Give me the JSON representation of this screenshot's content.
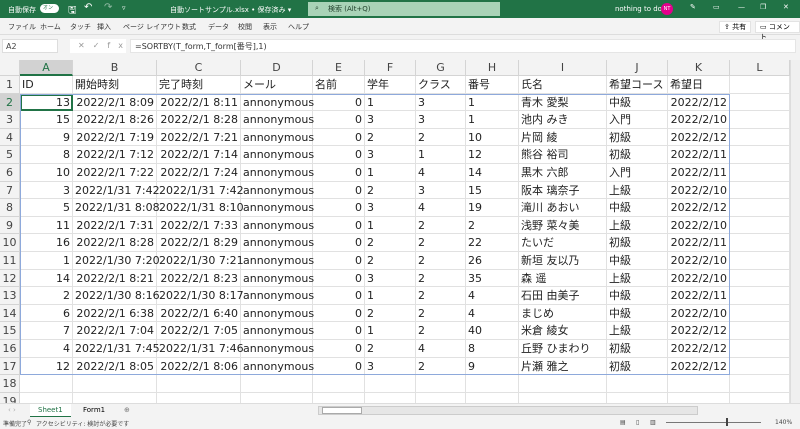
{
  "titlebar": {
    "autosave": "自動保存",
    "autosave_state": "オン",
    "filename": "自動ソートサンプル.xlsx • 保存済み ▾",
    "search": "検索 (Alt+Q)",
    "user": "nothing to do",
    "avatar": "NT"
  },
  "menu": [
    "ファイル",
    "ホーム",
    "タッチ",
    "挿入",
    "ページ レイアウト",
    "数式",
    "データ",
    "校閲",
    "表示",
    "ヘルプ"
  ],
  "share": "共有",
  "comment": "コメント",
  "formula_bar": {
    "name_box": "A2",
    "fx": "✕✓fx",
    "formula": "=SORTBY(T_form,T_form[番号],1)"
  },
  "columns": [
    "A",
    "B",
    "C",
    "D",
    "E",
    "F",
    "G",
    "H",
    "I",
    "J",
    "K",
    "L"
  ],
  "headers": [
    "ID",
    "開始時刻",
    "完了時刻",
    "メール",
    "名前",
    "学年",
    "クラス",
    "番号",
    "氏名",
    "希望コース",
    "希望日"
  ],
  "rows": [
    [
      "13",
      "2022/2/1 8:09",
      "2022/2/1 8:11",
      "annonymous",
      "0",
      "1",
      "3",
      "1",
      "青木 愛梨",
      "中級",
      "2022/2/12"
    ],
    [
      "15",
      "2022/2/1 8:26",
      "2022/2/1 8:28",
      "annonymous",
      "0",
      "3",
      "3",
      "1",
      "池内 みき",
      "入門",
      "2022/2/10"
    ],
    [
      "9",
      "2022/2/1 7:19",
      "2022/2/1 7:21",
      "annonymous",
      "0",
      "2",
      "2",
      "10",
      "片岡 綾",
      "初級",
      "2022/2/12"
    ],
    [
      "8",
      "2022/2/1 7:12",
      "2022/2/1 7:14",
      "annonymous",
      "0",
      "3",
      "1",
      "12",
      "熊谷 裕司",
      "初級",
      "2022/2/11"
    ],
    [
      "10",
      "2022/2/1 7:22",
      "2022/2/1 7:24",
      "annonymous",
      "0",
      "1",
      "4",
      "14",
      "黒木 六郎",
      "入門",
      "2022/2/11"
    ],
    [
      "3",
      "2022/1/31 7:42",
      "2022/1/31 7:42",
      "annonymous",
      "0",
      "2",
      "3",
      "15",
      "阪本 璃奈子",
      "上級",
      "2022/2/10"
    ],
    [
      "5",
      "2022/1/31 8:08",
      "2022/1/31 8:10",
      "annonymous",
      "0",
      "3",
      "4",
      "19",
      "滝川 あおい",
      "中級",
      "2022/2/12"
    ],
    [
      "11",
      "2022/2/1 7:31",
      "2022/2/1 7:33",
      "annonymous",
      "0",
      "1",
      "2",
      "2",
      "浅野 菜々美",
      "上級",
      "2022/2/10"
    ],
    [
      "16",
      "2022/2/1 8:28",
      "2022/2/1 8:29",
      "annonymous",
      "0",
      "2",
      "2",
      "22",
      "たいだ",
      "初級",
      "2022/2/11"
    ],
    [
      "1",
      "2022/1/30 7:20",
      "2022/1/30 7:21",
      "annonymous",
      "0",
      "2",
      "2",
      "26",
      "新垣 友以乃",
      "中級",
      "2022/2/10"
    ],
    [
      "14",
      "2022/2/1 8:21",
      "2022/2/1 8:23",
      "annonymous",
      "0",
      "3",
      "2",
      "35",
      "森 遥",
      "上級",
      "2022/2/10"
    ],
    [
      "2",
      "2022/1/30 8:16",
      "2022/1/30 8:17",
      "annonymous",
      "0",
      "1",
      "2",
      "4",
      "石田 由美子",
      "中級",
      "2022/2/11"
    ],
    [
      "6",
      "2022/2/1 6:38",
      "2022/2/1 6:40",
      "annonymous",
      "0",
      "2",
      "2",
      "4",
      "まじめ",
      "中級",
      "2022/2/10"
    ],
    [
      "7",
      "2022/2/1 7:04",
      "2022/2/1 7:05",
      "annonymous",
      "0",
      "1",
      "2",
      "40",
      "米倉 綾女",
      "上級",
      "2022/2/12"
    ],
    [
      "4",
      "2022/1/31 7:45",
      "2022/1/31 7:46",
      "annonymous",
      "0",
      "2",
      "4",
      "8",
      "丘野 ひまわり",
      "初級",
      "2022/2/12"
    ],
    [
      "12",
      "2022/2/1 8:05",
      "2022/2/1 8:06",
      "annonymous",
      "0",
      "3",
      "2",
      "9",
      "片瀬 雅之",
      "初級",
      "2022/2/12"
    ]
  ],
  "row_numbers": [
    "1",
    "2",
    "3",
    "4",
    "5",
    "6",
    "7",
    "8",
    "9",
    "10",
    "11",
    "12",
    "13",
    "14",
    "15",
    "16",
    "17",
    "18",
    "19"
  ],
  "sheets": [
    "Sheet1",
    "Form1"
  ],
  "status": {
    "ready": "準備完了",
    "accessibility": "アクセシビリティ: 検討が必要です",
    "zoom": "140%"
  },
  "colors": {
    "accent": "#217346",
    "avatar": "#e3008c",
    "table_border": "#8ea9db"
  }
}
